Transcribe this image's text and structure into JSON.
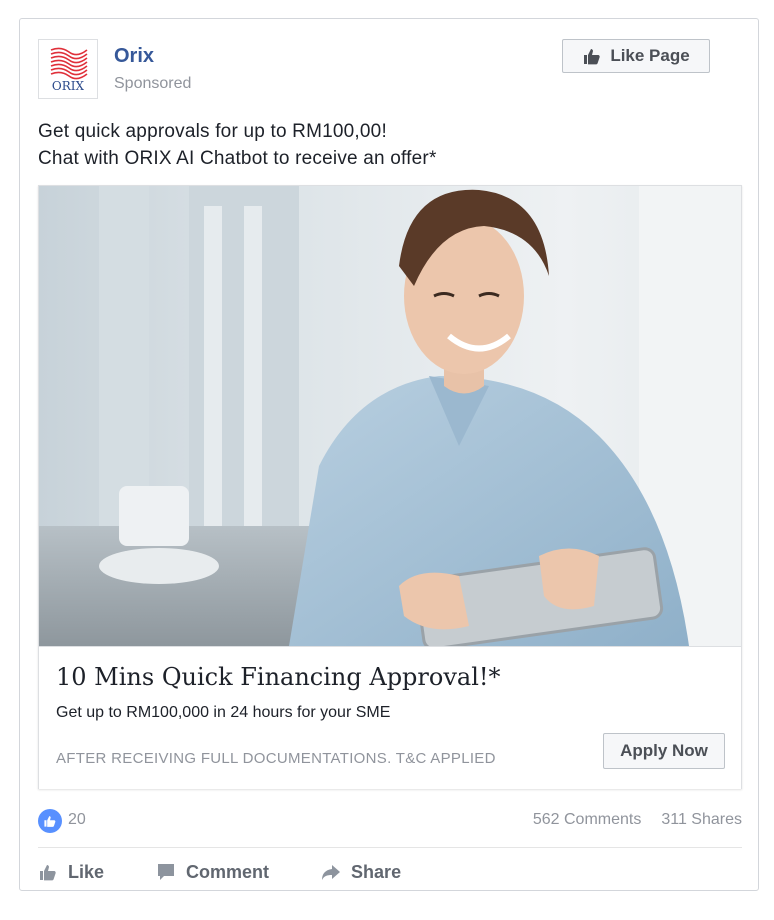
{
  "post": {
    "page_name": "Orix",
    "sponsored": "Sponsored",
    "like_page_label": "Like Page",
    "logo_text": "ORIX",
    "text_lines": [
      "Get quick approvals for up to RM100,00!",
      "Chat with ORIX AI Chatbot to receive an offer*"
    ]
  },
  "ad": {
    "headline": "10 Mins Quick Financing Approval!*",
    "description": "Get up to RM100,000 in 24 hours for your SME",
    "caption": "AFTER RECEIVING FULL DOCUMENTATIONS. T&C APPLIED",
    "cta_label": "Apply Now"
  },
  "stats": {
    "likes": "20",
    "comments": "562 Comments",
    "shares": "311 Shares"
  },
  "actions": {
    "like": "Like",
    "comment": "Comment",
    "share": "Share"
  },
  "colors": {
    "brand_red": "#e0303a",
    "link_blue": "#365899",
    "like_blue": "#5890ff",
    "muted_gray": "#90949c"
  }
}
